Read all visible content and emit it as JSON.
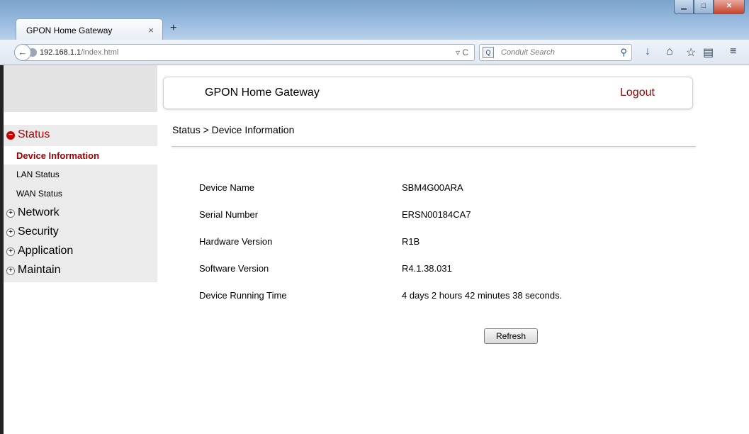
{
  "browser": {
    "tab_title": "GPON Home Gateway",
    "tab_close": "×",
    "new_tab": "+",
    "url_host": "192.168.1.1",
    "url_path": "/index.html",
    "search_placeholder": "Conduit Search",
    "window_controls": [
      "minimize",
      "maximize",
      "close"
    ]
  },
  "sidebar": {
    "status": {
      "label": "Status",
      "expanded": true
    },
    "items": [
      {
        "label": "Device Information",
        "current": true
      },
      {
        "label": "LAN Status"
      },
      {
        "label": "WAN Status"
      }
    ],
    "groups": [
      {
        "label": "Network"
      },
      {
        "label": "Security"
      },
      {
        "label": "Application"
      },
      {
        "label": "Maintain"
      }
    ]
  },
  "header": {
    "title": "GPON Home Gateway",
    "logout": "Logout"
  },
  "breadcrumb": "Status > Device Information",
  "device_info": [
    {
      "label": "Device Name",
      "value": "SBM4G00ARA"
    },
    {
      "label": "Serial Number",
      "value": "ERSN00184CA7"
    },
    {
      "label": "Hardware Version",
      "value": "R1B"
    },
    {
      "label": "Software Version",
      "value": "R4.1.38.031"
    },
    {
      "label": "Device Running Time",
      "value": "4 days 2 hours 42 minutes 38 seconds."
    }
  ],
  "refresh_label": "Refresh",
  "colors": {
    "accent_red": "#a00000",
    "sidebar_bg": "#ebebeb"
  }
}
